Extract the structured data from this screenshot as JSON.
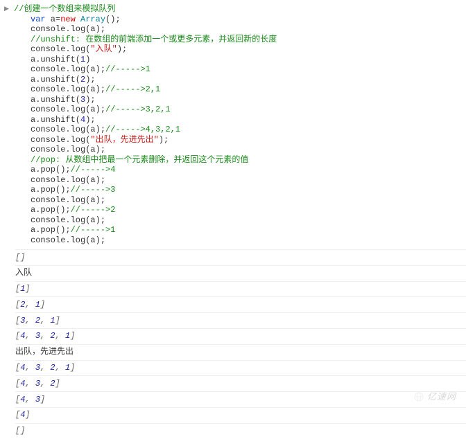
{
  "code": {
    "line1_comment": "//创建一个数组来模拟队列",
    "var_kw": "var",
    "var_name": " a=",
    "new_kw": "new",
    "array_type": " Array",
    "paren_semi": "();",
    "log_a": "console.log(a);",
    "line4_comment": "//unshift: 在数组的前端添加一个或更多元素，并返回新的长度",
    "log_open": "console.log(",
    "str_enqueue": "\"入队\"",
    "close_semi": ");",
    "unshift_open": "a.unshift(",
    "n1": "1",
    "n2": "2",
    "n3": "3",
    "n4": "4",
    "c_r1": "//----->1",
    "c_r21": "//----->2,1",
    "c_r321": "//----->3,2,1",
    "c_r4321": "//----->4,3,2,1",
    "str_dequeue": "\"出队，先进先出\"",
    "pop_comment": "//pop: 从数组中把最一个元素删除，并返回这个元素的值",
    "pop_call": "a.pop();",
    "c_p4": "//----->4",
    "c_p3": "//----->3",
    "c_p2": "//----->2",
    "c_p1": "//----->1"
  },
  "output": {
    "o1": "[]",
    "o2": "入队",
    "o3": "[1]",
    "o4": "[2, 1]",
    "o5": "[3, 2, 1]",
    "o6": "[4, 3, 2, 1]",
    "o7": "出队，先进先出",
    "o8": "[4, 3, 2, 1]",
    "o9": "[4, 3, 2]",
    "o10": "[4, 3]",
    "o11": "[4]",
    "o12": "[]"
  },
  "watermark": {
    "text": "亿速网"
  }
}
